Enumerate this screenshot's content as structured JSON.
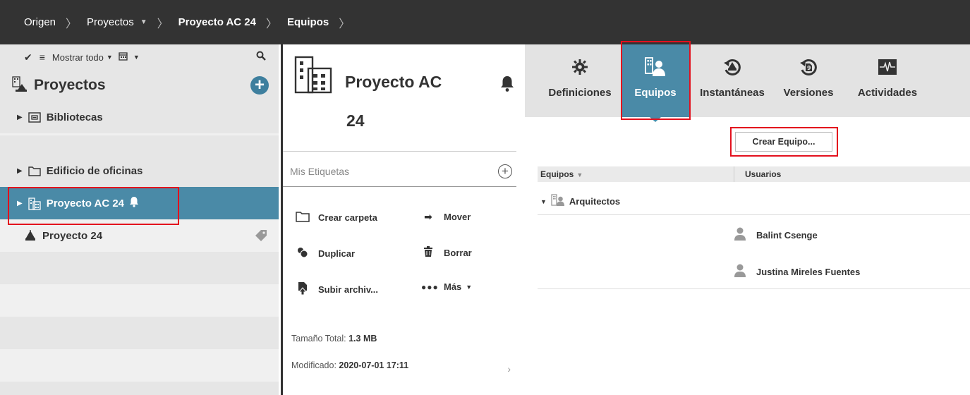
{
  "breadcrumb": {
    "items": [
      {
        "label": "Origen"
      },
      {
        "label": "Proyectos"
      },
      {
        "label": "Proyecto AC 24"
      },
      {
        "label": "Equipos"
      }
    ]
  },
  "left": {
    "toolbar": {
      "show_all": "Mostrar todo"
    },
    "title": "Proyectos",
    "tree": [
      {
        "label": "Bibliotecas",
        "icon": "library-icon"
      },
      {
        "label": "Edificio de oficinas",
        "icon": "folder-icon"
      },
      {
        "label": "Proyecto AC 24",
        "icon": "building-icon",
        "selected": true
      },
      {
        "label": "Proyecto 24",
        "icon": "project-icon"
      }
    ]
  },
  "middle": {
    "title_line1": "Proyecto AC",
    "title_line2": "24",
    "tags_label": "Mis Etiquetas",
    "actions": {
      "create_folder": "Crear carpeta",
      "move": "Mover",
      "duplicate": "Duplicar",
      "delete": "Borrar",
      "upload": "Subir archiv...",
      "more": "Más"
    },
    "size_label": "Tamaño Total:",
    "size_value": "1.3 MB",
    "modified_label": "Modificado:",
    "modified_value": "2020-07-01 17:11"
  },
  "right": {
    "tabs": [
      {
        "label": "Definiciones",
        "icon": "gear-icon"
      },
      {
        "label": "Equipos",
        "icon": "teams-icon",
        "active": true
      },
      {
        "label": "Instantáneas",
        "icon": "snapshot-icon"
      },
      {
        "label": "Versiones",
        "icon": "versions-icon"
      },
      {
        "label": "Actividades",
        "icon": "activity-icon"
      }
    ],
    "create_button": "Crear Equipo...",
    "columns": {
      "teams": "Equipos",
      "users": "Usuarios"
    },
    "group": "Arquitectos",
    "users": [
      "Balint Csenge",
      "Justina Mireles Fuentes"
    ]
  },
  "colors": {
    "accent": "#4a8aa7",
    "highlight_box": "#e3101d",
    "topbar": "#333333"
  }
}
